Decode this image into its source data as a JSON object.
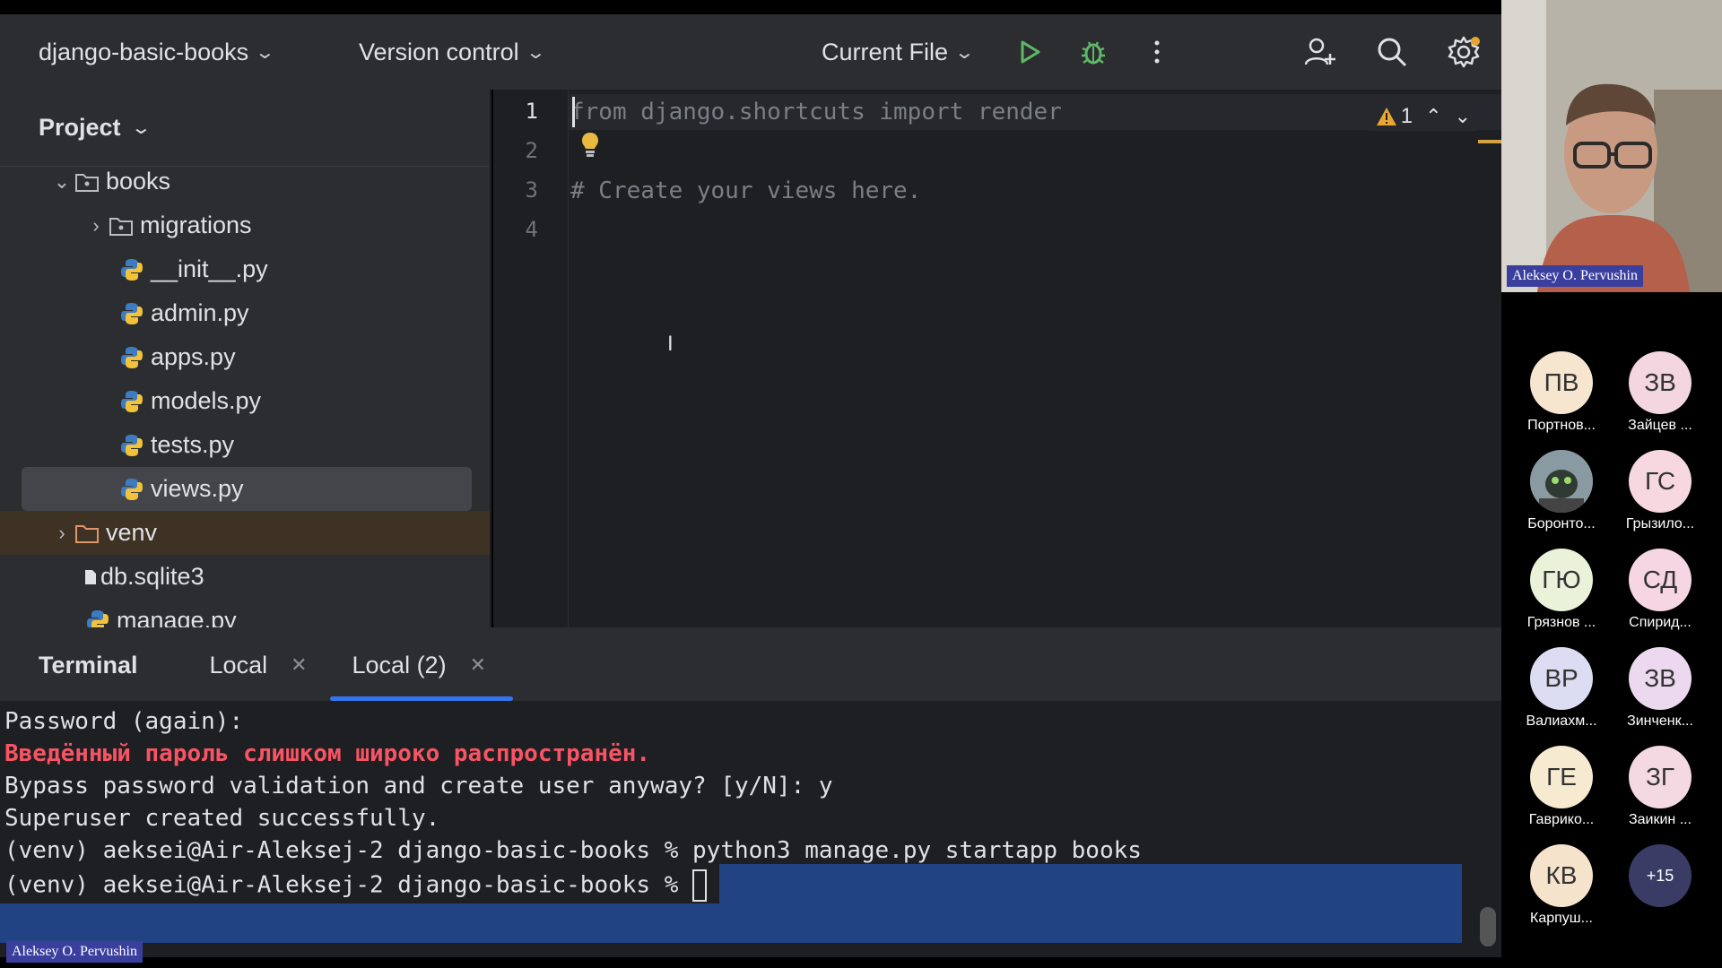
{
  "topbar": {
    "project_name": "django-basic-books",
    "version_control": "Version control",
    "run_config": "Current File"
  },
  "project_panel": {
    "title": "Project",
    "tree": [
      {
        "label": "books",
        "type": "folder",
        "expanded": true
      },
      {
        "label": "migrations",
        "type": "folder",
        "expanded": false
      },
      {
        "label": "__init__.py",
        "type": "python"
      },
      {
        "label": "admin.py",
        "type": "python"
      },
      {
        "label": "apps.py",
        "type": "python"
      },
      {
        "label": "models.py",
        "type": "python"
      },
      {
        "label": "tests.py",
        "type": "python"
      },
      {
        "label": "views.py",
        "type": "python",
        "selected": true
      },
      {
        "label": "venv",
        "type": "folder",
        "expanded": false,
        "excluded": true
      },
      {
        "label": "db.sqlite3",
        "type": "file"
      },
      {
        "label": "manage.py",
        "type": "python"
      }
    ]
  },
  "editor": {
    "line_numbers": [
      "1",
      "2",
      "3",
      "4"
    ],
    "lines": [
      "from django.shortcuts import render",
      "",
      "# Create your views here.",
      ""
    ],
    "warnings_count": "1"
  },
  "terminal": {
    "title": "Terminal",
    "tabs": [
      {
        "label": "Local",
        "active": false
      },
      {
        "label": "Local (2)",
        "active": true
      }
    ],
    "lines": [
      "Password (again):",
      "Введённый пароль слишком широко распространён.",
      "Bypass password validation and create user anyway? [y/N]: y",
      "Superuser created successfully."
    ],
    "prompt": "(venv) aeksei@Air-Aleksej-2 django-basic-books % ",
    "command": "python3 manage.py startapp books",
    "prompt2": "(venv) aeksei@Air-Aleksej-2 django-basic-books % "
  },
  "video": {
    "speaker_name": "Aleksey O. Pervushin",
    "screen_owner": "Aleksey O. Pervushin"
  },
  "participants": [
    {
      "initials": "ПВ",
      "name": "Портнов...",
      "color": "#f6e6cf"
    },
    {
      "initials": "ЗВ",
      "name": "Зайцев ...",
      "color": "#f3d6e0"
    },
    {
      "initials": "",
      "name": "Боронто...",
      "color": "#6b7f8a"
    },
    {
      "initials": "ГС",
      "name": "Грызило...",
      "color": "#f7d8e0"
    },
    {
      "initials": "ГЮ",
      "name": "Грязнов ...",
      "color": "#eaf2d9"
    },
    {
      "initials": "СД",
      "name": "Спирид...",
      "color": "#f6d6e2"
    },
    {
      "initials": "ВР",
      "name": "Валиахм...",
      "color": "#dcdcf2"
    },
    {
      "initials": "ЗВ",
      "name": "Зинченк...",
      "color": "#ecd9ef"
    },
    {
      "initials": "ГЕ",
      "name": "Гаврико...",
      "color": "#f6ead0"
    },
    {
      "initials": "ЗГ",
      "name": "Заикин ...",
      "color": "#f4d9e3"
    },
    {
      "initials": "КВ",
      "name": "Карпуш...",
      "color": "#f6e3cc"
    },
    {
      "initials": "+15",
      "name": "",
      "color": "#3b3c66"
    }
  ]
}
